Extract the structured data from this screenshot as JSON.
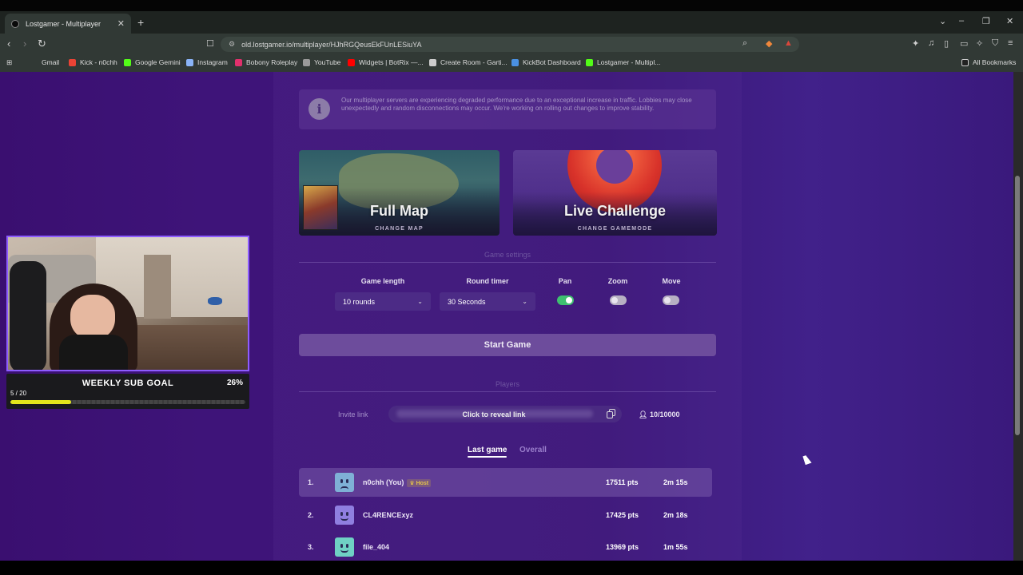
{
  "browser": {
    "tab_title": "Lostgamer - Multiplayer",
    "tab_close": "✕",
    "new_tab": "+",
    "url": "old.lostgamer.io/multiplayer/HJhRGQeusEkFUnLESiuYA",
    "bookmarks": [
      {
        "label": "Gmail",
        "color": "#ea4335"
      },
      {
        "label": "Kick - n0chh",
        "color": "#53fc18"
      },
      {
        "label": "Google Gemini",
        "color": "#8ab4f8"
      },
      {
        "label": "Instagram",
        "color": "#e1306c"
      },
      {
        "label": "Bobony Roleplay",
        "color": "#9a9a9a"
      },
      {
        "label": "YouTube",
        "color": "#ff0000"
      },
      {
        "label": "Widgets | BotRix —...",
        "color": "#cccccc"
      },
      {
        "label": "Create Room - Garti...",
        "color": "#4a90e2"
      },
      {
        "label": "KickBot Dashboard",
        "color": "#53fc18"
      },
      {
        "label": "Lostgamer - Multipl...",
        "color": "#222222"
      }
    ],
    "all_bookmarks": "All Bookmarks"
  },
  "notice": {
    "icon": "i",
    "text": "Our multiplayer servers are experiencing degraded performance due to an exceptional increase in traffic. Lobbies may close unexpectedly and random disconnections may occur. We're working on rolling out changes to improve stability."
  },
  "cards": {
    "map": {
      "title": "Full Map",
      "subtitle": "CHANGE MAP"
    },
    "mode": {
      "title": "Live Challenge",
      "subtitle": "CHANGE GAMEMODE"
    }
  },
  "settings": {
    "heading": "Game settings",
    "game_length_label": "Game length",
    "game_length_value": "10 rounds",
    "round_timer_label": "Round timer",
    "round_timer_value": "30 Seconds",
    "pan_label": "Pan",
    "pan_on": true,
    "zoom_label": "Zoom",
    "zoom_on": false,
    "move_label": "Move",
    "move_on": false
  },
  "start_button": "Start Game",
  "players": {
    "heading": "Players",
    "invite_label": "Invite link",
    "invite_reveal": "Click to reveal link",
    "count": "10/10000"
  },
  "leaderboard": {
    "tabs": [
      "Last game",
      "Overall"
    ],
    "rows": [
      {
        "rank": "1.",
        "name": "n0chh (You)",
        "host": "Host",
        "pts": "17511 pts",
        "time": "2m 15s",
        "avatar_color": "#7fb0d6"
      },
      {
        "rank": "2.",
        "name": "CL4RENCExyz",
        "pts": "17425 pts",
        "time": "2m 18s",
        "avatar_color": "#8f7fe0"
      },
      {
        "rank": "3.",
        "name": "file_404",
        "pts": "13969 pts",
        "time": "1m 55s",
        "avatar_color": "#6fd0c4"
      }
    ]
  },
  "stream": {
    "sub_goal_title": "WEEKLY SUB GOAL",
    "sub_goal_pct": "26%",
    "sub_goal_count": "5 / 20",
    "sub_goal_fraction": 0.26
  },
  "colors": {
    "accent": "#8d5cff",
    "toggle_on": "#3fc070",
    "goal_fill": "#e3e51c"
  }
}
